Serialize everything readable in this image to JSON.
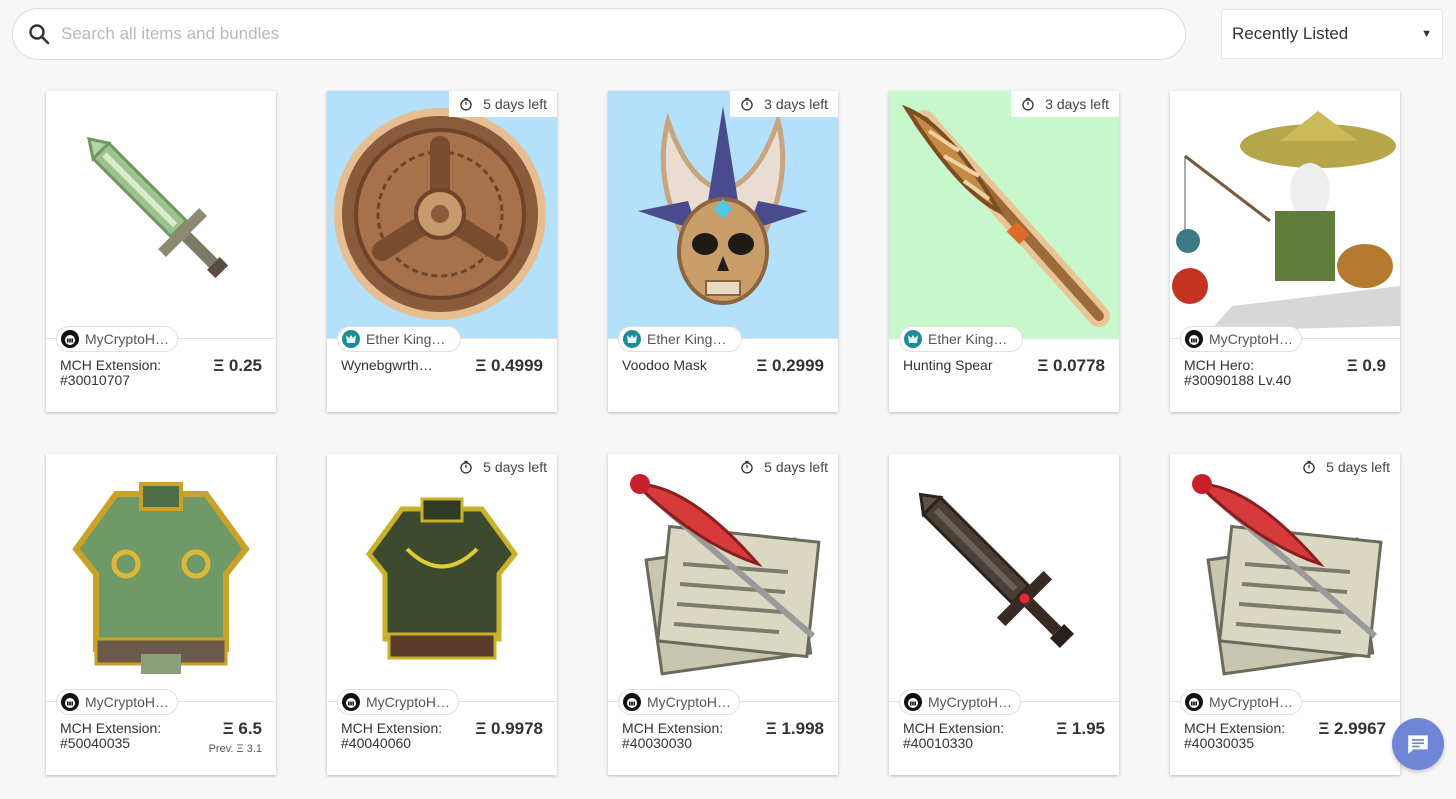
{
  "search": {
    "placeholder": "Search all items and bundles"
  },
  "sort": {
    "selected": "Recently Listed"
  },
  "colors": {
    "mch_logo": "#111111",
    "ek_logo": "#1b8d95",
    "chat_button": "#6f86d6",
    "sky_bg": "#b3e0fb",
    "mint_bg": "#c9f7cc"
  },
  "cards": [
    {
      "timer": "",
      "collection": "MyCryptoH…",
      "collection_icon": "mch-logo-icon",
      "name": "MCH Extension: #30010707",
      "price": "Ξ 0.25",
      "prev": "",
      "art": "green-sword"
    },
    {
      "timer": "5 days left",
      "collection": "Ether Kingd…",
      "collection_icon": "ether-kingdoms-logo-icon",
      "name": "Wynebgwrth…",
      "price": "Ξ 0.4999",
      "prev": "",
      "art": "round-shield"
    },
    {
      "timer": "3 days left",
      "collection": "Ether Kingd…",
      "collection_icon": "ether-kingdoms-logo-icon",
      "name": "Voodoo Mask",
      "price": "Ξ 0.2999",
      "prev": "",
      "art": "voodoo-mask"
    },
    {
      "timer": "3 days left",
      "collection": "Ether Kingd…",
      "collection_icon": "ether-kingdoms-logo-icon",
      "name": "Hunting Spear",
      "price": "Ξ 0.0778",
      "prev": "",
      "art": "hunting-spear"
    },
    {
      "timer": "",
      "collection": "MyCryptoH…",
      "collection_icon": "mch-logo-icon",
      "name": "MCH Hero: #30090188 Lv.40",
      "price": "Ξ 0.9",
      "prev": "",
      "art": "fisherman-hero"
    },
    {
      "timer": "",
      "collection": "MyCryptoH…",
      "collection_icon": "mch-logo-icon",
      "name": "MCH Extension: #50040035",
      "price": "Ξ 6.5",
      "prev": "Prev. Ξ 3.1",
      "art": "gold-armor"
    },
    {
      "timer": "5 days left",
      "collection": "MyCryptoH…",
      "collection_icon": "mch-logo-icon",
      "name": "MCH Extension: #40040060",
      "price": "Ξ 0.9978",
      "prev": "",
      "art": "dark-armor"
    },
    {
      "timer": "5 days left",
      "collection": "MyCryptoH…",
      "collection_icon": "mch-logo-icon",
      "name": "MCH Extension: #40030030",
      "price": "Ξ 1.998",
      "prev": "",
      "art": "quill-scroll"
    },
    {
      "timer": "",
      "collection": "MyCryptoH…",
      "collection_icon": "mch-logo-icon",
      "name": "MCH Extension: #40010330",
      "price": "Ξ 1.95",
      "prev": "",
      "art": "dark-sword"
    },
    {
      "timer": "5 days left",
      "collection": "MyCryptoH…",
      "collection_icon": "mch-logo-icon",
      "name": "MCH Extension: #40030035",
      "price": "Ξ 2.9967",
      "prev": "",
      "art": "quill-scroll"
    }
  ]
}
